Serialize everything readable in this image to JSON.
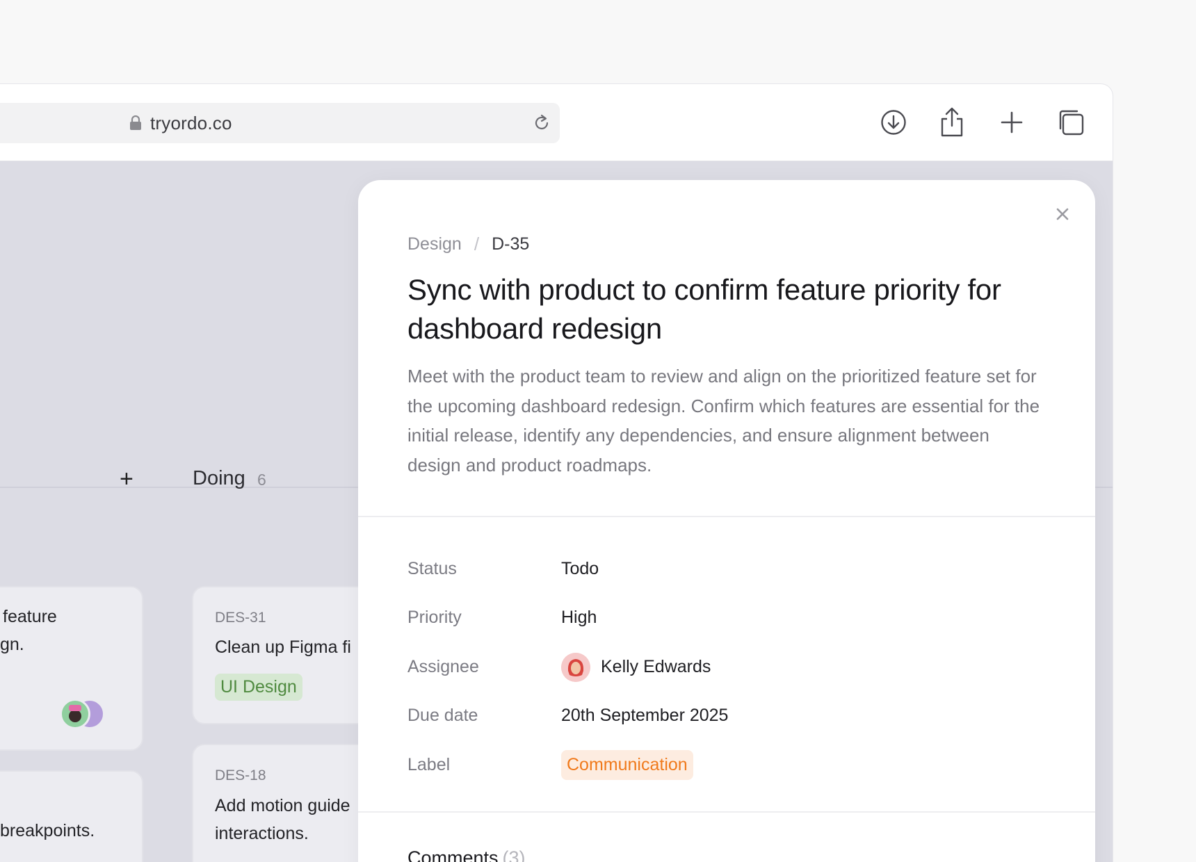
{
  "browser": {
    "url": "tryordo.co"
  },
  "board": {
    "column": {
      "title": "Doing",
      "count": "6"
    },
    "left_cards": [
      {
        "line1": "feature",
        "line2": "gn."
      },
      {
        "line1": "breakpoints."
      }
    ],
    "cards": [
      {
        "id": "DES-31",
        "title": "Clean up Figma fi",
        "tag": "UI Design"
      },
      {
        "id": "DES-18",
        "title_line1": "Add motion guide",
        "title_line2": "interactions."
      }
    ]
  },
  "modal": {
    "breadcrumb": {
      "project": "Design",
      "separator": "/",
      "id": "D-35"
    },
    "title": "Sync with product to confirm feature priority for dashboard redesign",
    "description": "Meet with the product team to review and align on the prioritized feature set for the upcoming dashboard redesign. Confirm which features are essential for the initial release, identify any dependencies, and ensure alignment between design and product roadmaps.",
    "properties": {
      "status_label": "Status",
      "status_value": "Todo",
      "priority_label": "Priority",
      "priority_value": "High",
      "assignee_label": "Assignee",
      "assignee_value": "Kelly Edwards",
      "due_label": "Due date",
      "due_value": "20th September 2025",
      "label_label": "Label",
      "label_value": "Communication"
    },
    "comments": {
      "title": "Comments",
      "count": "(3)"
    }
  },
  "colors": {
    "accent_orange": "#f07a1c",
    "label_bg": "#fdece0",
    "tag_green": "#4f8a3f",
    "board_bg": "#dcdce4"
  },
  "icons": [
    "lock-icon",
    "reload-icon",
    "download-icon",
    "share-icon",
    "plus-icon",
    "tabs-icon",
    "close-icon"
  ]
}
